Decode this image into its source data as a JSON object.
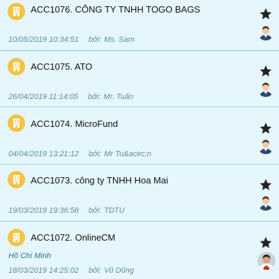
{
  "items": [
    {
      "title": "ACC1076. CÔNG TY TNHH TOGO BAGS",
      "subtitle": "",
      "date": "10/05/2019 10:34:51",
      "by_label": "bởi:",
      "author": "Ms. Sam",
      "icon": "building-icon",
      "avatar": "default-user-avatar"
    },
    {
      "title": "ACC1075. ATO",
      "subtitle": "",
      "date": "26/04/2019 11:14:05",
      "by_label": "bởi:",
      "author": "Mr. Tuấn",
      "icon": "building-icon",
      "avatar": "default-user-avatar"
    },
    {
      "title": "ACC1074. MicroFund",
      "subtitle": "",
      "date": "04/04/2019 13:21:12",
      "by_label": "bởi:",
      "author": "Mr Tu&acirc;n",
      "icon": "building-icon",
      "avatar": "default-user-avatar"
    },
    {
      "title": "ACC1073. công ty TNHH Hoa Mai",
      "subtitle": "",
      "date": "19/03/2019 19:36:58",
      "by_label": "bởi:",
      "author": "TDTU",
      "icon": "building-icon",
      "avatar": "default-user-avatar"
    },
    {
      "title": "ACC1072. OnlineCM",
      "subtitle": "Hồ Chí Minh",
      "date": "18/03/2019 14:25:02",
      "by_label": "bởi:",
      "author": "Vũ Dũng",
      "icon": "building-icon",
      "avatar": "photo-user-avatar"
    }
  ],
  "colors": {
    "card_bg": "#e6f6fd",
    "divider": "#7fd0ec",
    "icon_bg": "#f5c342",
    "meta_text": "#5b8ea0"
  }
}
